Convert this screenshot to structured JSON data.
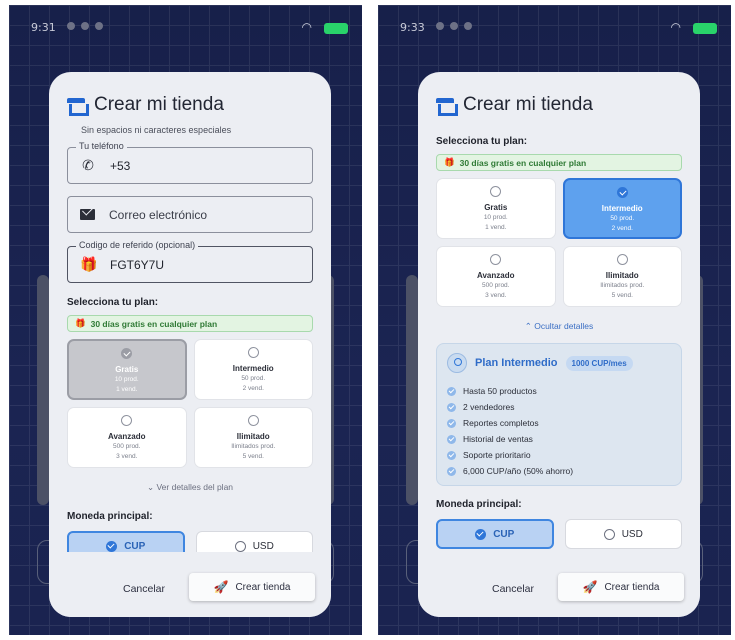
{
  "left": {
    "status_time": "9:31",
    "title": "Crear mi tienda",
    "hint": "Sin espacios ni caracteres especiales",
    "phone": {
      "legend": "Tu teléfono",
      "value": "+53"
    },
    "email": {
      "placeholder": "Correo electrónico"
    },
    "referral": {
      "legend": "Codigo de referido (opcional)",
      "value": "FGT6Y7U"
    },
    "plan_section": "Selecciona tu plan:",
    "promo": "30 días gratis en cualquier plan",
    "plans": [
      {
        "name": "Gratis",
        "products": "10 prod.",
        "sellers": "1 vend."
      },
      {
        "name": "Intermedio",
        "products": "50 prod.",
        "sellers": "2 vend."
      },
      {
        "name": "Avanzado",
        "products": "500 prod.",
        "sellers": "3 vend."
      },
      {
        "name": "Ilimitado",
        "products": "Ilimitados prod.",
        "sellers": "5 vend."
      }
    ],
    "details_toggle": "Ver detalles del plan",
    "currency_section": "Moneda principal:",
    "currencies": [
      "CUP",
      "USD"
    ],
    "cancel": "Cancelar",
    "create": "Crear tienda"
  },
  "right": {
    "status_time": "9:33",
    "title": "Crear mi tienda",
    "plan_section": "Selecciona tu plan:",
    "promo": "30 días gratis en cualquier plan",
    "plans": [
      {
        "name": "Gratis",
        "products": "10 prod.",
        "sellers": "1 vend."
      },
      {
        "name": "Intermedio",
        "products": "50 prod.",
        "sellers": "2 vend."
      },
      {
        "name": "Avanzado",
        "products": "500 prod.",
        "sellers": "3 vend."
      },
      {
        "name": "Ilimitado",
        "products": "Ilimitados prod.",
        "sellers": "5 vend."
      }
    ],
    "details_toggle": "Ocultar detalles",
    "details": {
      "title": "Plan Intermedio",
      "price": "1000 CUP/mes",
      "features": [
        "Hasta 50 productos",
        "2 vendedores",
        "Reportes completos",
        "Historial de ventas",
        "Soporte prioritario",
        "6,000 CUP/año (50% ahorro)"
      ]
    },
    "currency_section": "Moneda principal:",
    "currencies": [
      "CUP",
      "USD"
    ],
    "cancel": "Cancelar",
    "create": "Crear tienda"
  },
  "colors": {
    "accent": "#2f76d8",
    "success": "#2f7a35",
    "background": "#1b2452"
  },
  "icons": [
    "store-icon",
    "phone-icon",
    "mail-icon",
    "gift-icon",
    "check-icon",
    "chevron-down-icon",
    "chevron-up-icon",
    "rocket-icon",
    "medal-icon",
    "wifi-icon",
    "battery-icon"
  ]
}
